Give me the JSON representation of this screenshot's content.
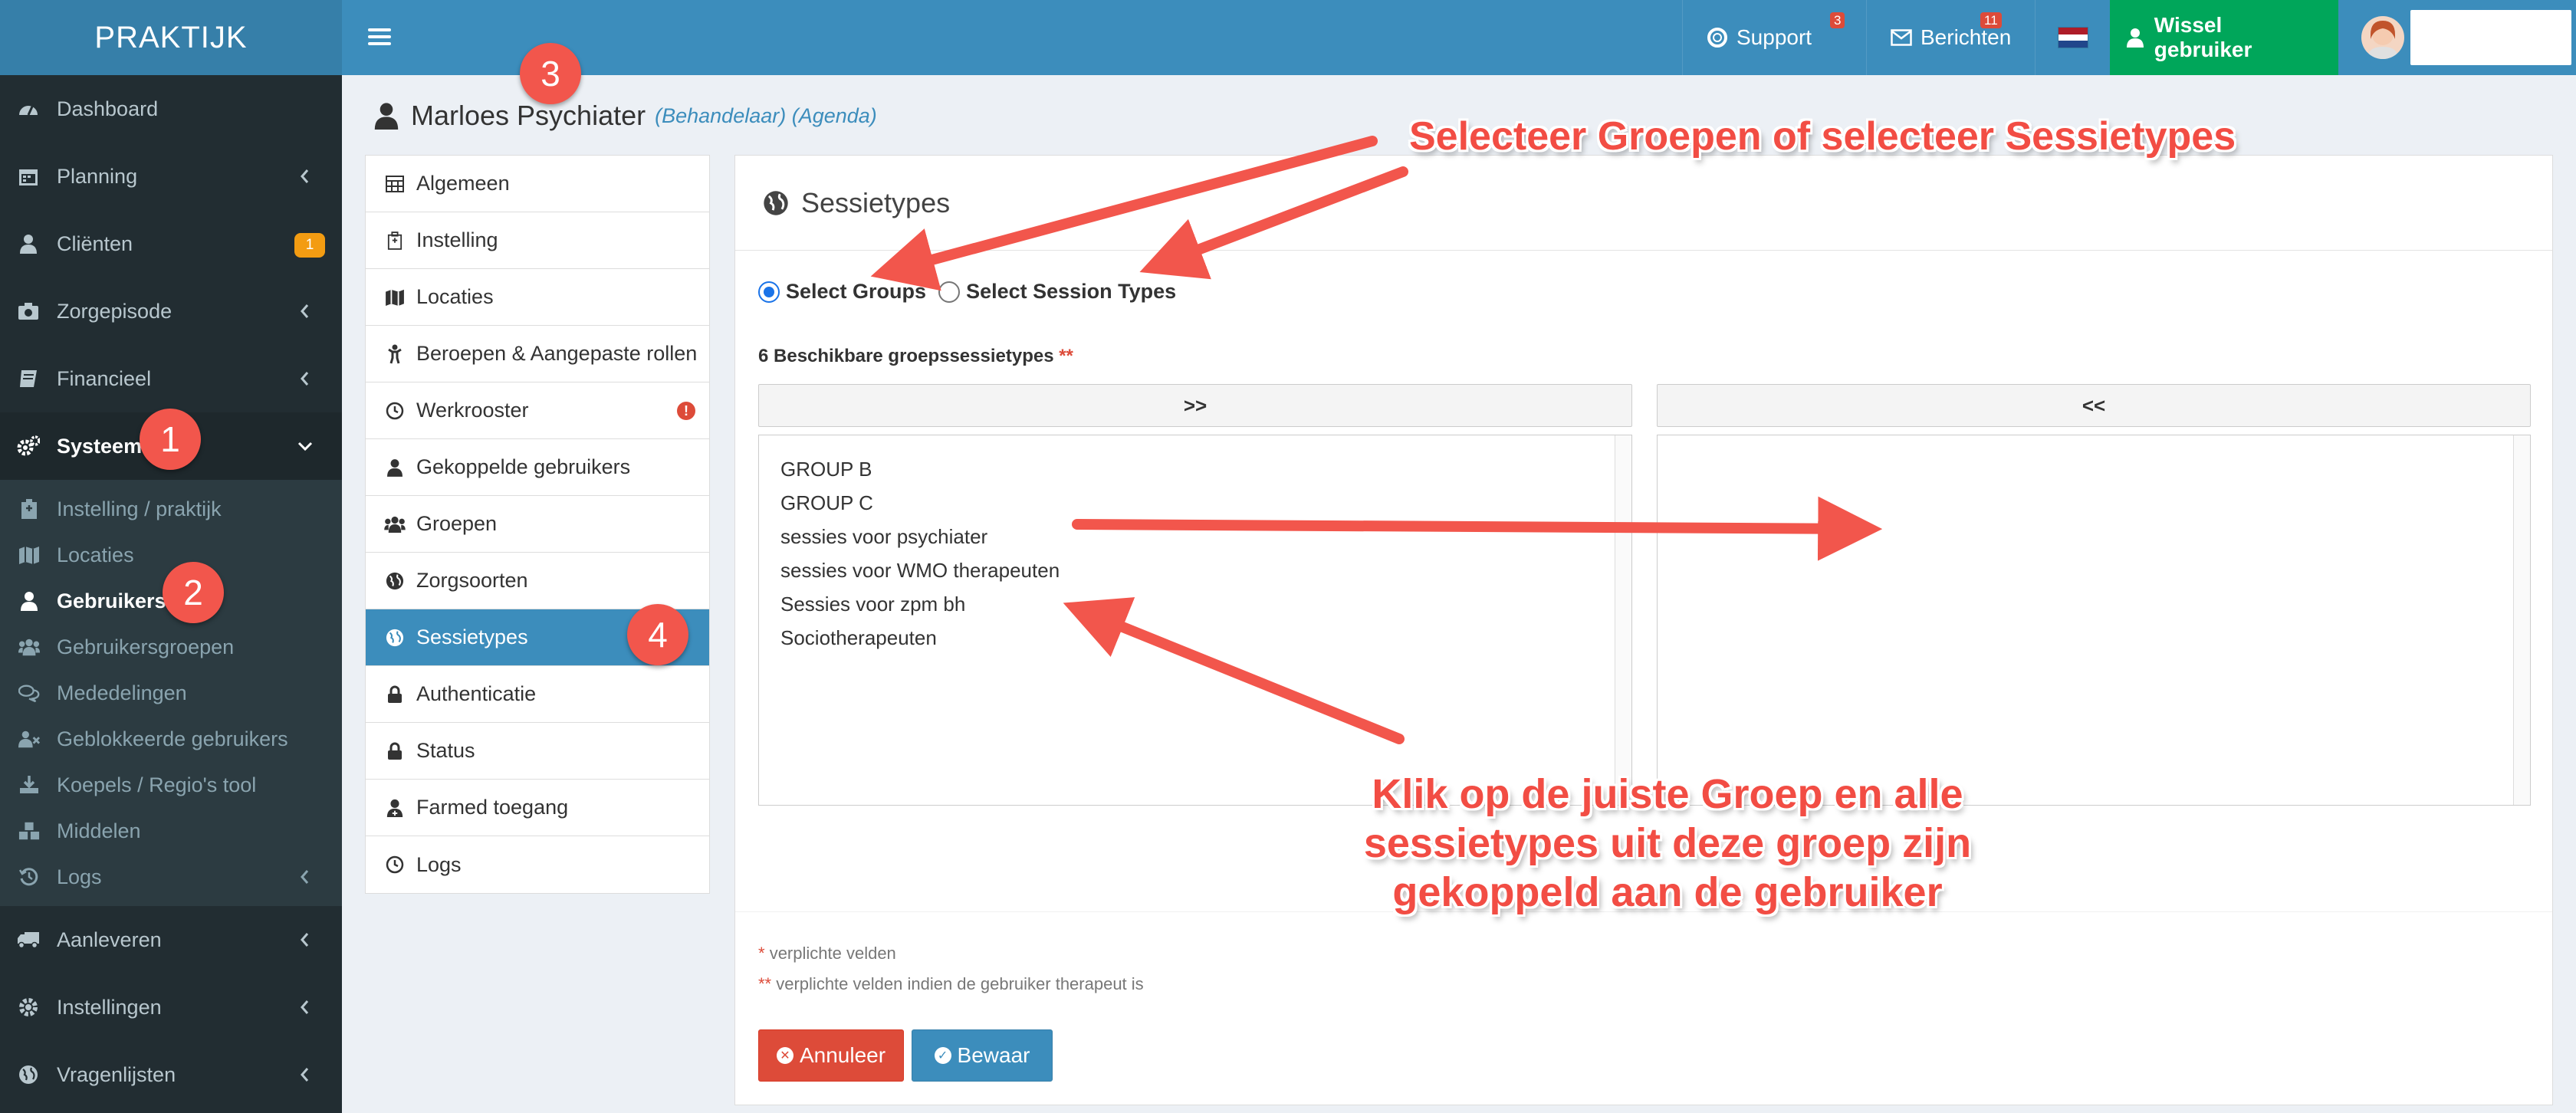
{
  "app": {
    "logo_text": "PRAKTIJK"
  },
  "topbar": {
    "support_label": "Support",
    "support_count": "3",
    "berichten_label": "Berichten",
    "berichten_count": "11",
    "wissel_label": "Wissel gebruiker"
  },
  "sidebar": {
    "items_top": [
      {
        "label": "Dashboard",
        "icon": "dashboard-icon"
      },
      {
        "label": "Planning",
        "icon": "calendar-icon"
      },
      {
        "label": "Cliënten",
        "icon": "user-icon",
        "badge": "1"
      },
      {
        "label": "Zorgepisode",
        "icon": "camera-icon"
      },
      {
        "label": "Financieel",
        "icon": "book-icon"
      },
      {
        "label": "Systeem",
        "icon": "cogs-icon"
      }
    ],
    "sub_items": [
      {
        "label": "Instelling / praktijk",
        "icon": "hospital-icon"
      },
      {
        "label": "Locaties",
        "icon": "map-icon"
      },
      {
        "label": "Gebruikers",
        "icon": "user-icon"
      },
      {
        "label": "Gebruikersgroepen",
        "icon": "users-icon"
      },
      {
        "label": "Mededelingen",
        "icon": "comments-icon"
      },
      {
        "label": "Geblokkeerde gebruikers",
        "icon": "user-times-icon"
      },
      {
        "label": "Koepels / Regio's tool",
        "icon": "download-icon"
      },
      {
        "label": "Middelen",
        "icon": "cubes-icon"
      },
      {
        "label": "Logs",
        "icon": "clock-icon"
      }
    ],
    "items_bottom": [
      {
        "label": "Aanleveren",
        "icon": "truck-icon"
      },
      {
        "label": "Instellingen",
        "icon": "cog-icon"
      },
      {
        "label": "Vragenlijsten",
        "icon": "globe-icon"
      }
    ]
  },
  "page": {
    "user_name": "Marloes Psychiater",
    "user_sub": "(Behandelaar) (Agenda)"
  },
  "user_nav": [
    {
      "label": "Algemeen",
      "icon": "table-icon"
    },
    {
      "label": "Instelling",
      "icon": "hospital-icon"
    },
    {
      "label": "Locaties",
      "icon": "map-icon"
    },
    {
      "label": "Beroepen & Aangepaste rollen",
      "icon": "child-icon"
    },
    {
      "label": "Werkrooster",
      "icon": "clock-icon",
      "alert": "!"
    },
    {
      "label": "Gekoppelde gebruikers",
      "icon": "user-icon"
    },
    {
      "label": "Groepen",
      "icon": "users-icon"
    },
    {
      "label": "Zorgsoorten",
      "icon": "globe-icon"
    },
    {
      "label": "Sessietypes",
      "icon": "globe-icon",
      "active": true
    },
    {
      "label": "Authenticatie",
      "icon": "lock-icon"
    },
    {
      "label": "Status",
      "icon": "lock-icon"
    },
    {
      "label": "Farmed toegang",
      "icon": "user-md-icon"
    },
    {
      "label": "Logs",
      "icon": "clock-icon"
    }
  ],
  "panel": {
    "title": "Sessietypes",
    "radio_groups": "Select Groups",
    "radio_session_types": "Select Session Types",
    "available_label": "6 Beschikbare groepssessietypes",
    "required_mark": "**",
    "move_right": ">>",
    "move_left": "<<",
    "available_options": [
      "GROUP B",
      "GROUP C",
      "sessies voor psychiater",
      "sessies voor WMO therapeuten",
      "Sessies voor zpm bh",
      "Sociotherapeuten"
    ],
    "note1_mark": "*",
    "note1_text": "verplichte velden",
    "note2_mark": "**",
    "note2_text": "verplichte velden indien de gebruiker therapeut is",
    "cancel_label": "Annuleer",
    "save_label": "Bewaar"
  },
  "annotations": {
    "marker1": "1",
    "marker2": "2",
    "marker3": "3",
    "marker4": "4",
    "callout_top": "Selecteer Groepen of selecteer Sessietypes",
    "callout_bottom": "Klik op de juiste Groep en alle sessietypes uit deze groep zijn gekoppeld aan de gebruiker",
    "color": "#f2564c"
  },
  "colors": {
    "brand": "#3c8dbc",
    "sidebar": "#222d32",
    "success": "#00a65a",
    "danger": "#dd4b39"
  }
}
